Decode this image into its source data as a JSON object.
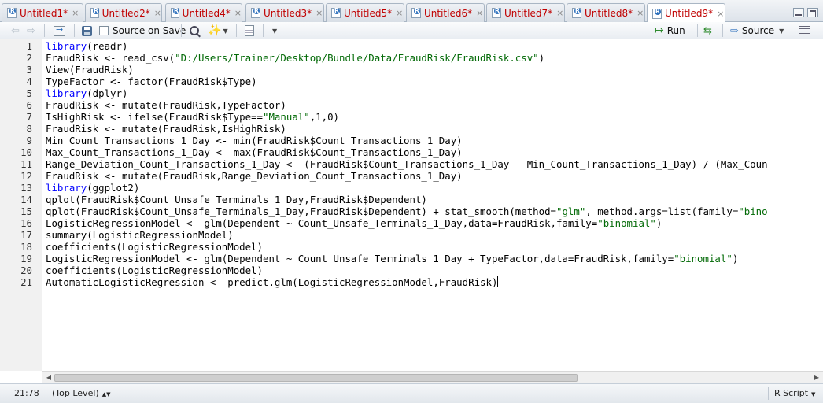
{
  "tabs": [
    {
      "label": "Untitled1*"
    },
    {
      "label": "Untitled2*"
    },
    {
      "label": "Untitled4*"
    },
    {
      "label": "Untitled3*"
    },
    {
      "label": "Untitled5*"
    },
    {
      "label": "Untitled6*"
    },
    {
      "label": "Untitled7*"
    },
    {
      "label": "Untitled8*"
    },
    {
      "label": "Untitled9*",
      "active": true
    }
  ],
  "tab_close_glyph": "×",
  "toolbar": {
    "source_on_save_label": "Source on Save",
    "run_label": "Run",
    "source_label": "Source"
  },
  "editor": {
    "lines": [
      {
        "n": "1",
        "code": "library(readr)"
      },
      {
        "n": "2",
        "code": "FraudRisk <- read_csv(\"D:/Users/Trainer/Desktop/Bundle/Data/FraudRisk/FraudRisk.csv\")"
      },
      {
        "n": "3",
        "code": "View(FraudRisk)"
      },
      {
        "n": "4",
        "code": "TypeFactor <- factor(FraudRisk$Type)"
      },
      {
        "n": "5",
        "code": "library(dplyr)"
      },
      {
        "n": "6",
        "code": "FraudRisk <- mutate(FraudRisk,TypeFactor)"
      },
      {
        "n": "7",
        "code": "IsHighRisk <- ifelse(FraudRisk$Type==\"Manual\",1,0)"
      },
      {
        "n": "8",
        "code": "FraudRisk <- mutate(FraudRisk,IsHighRisk)"
      },
      {
        "n": "9",
        "code": "Min_Count_Transactions_1_Day <- min(FraudRisk$Count_Transactions_1_Day)"
      },
      {
        "n": "10",
        "code": "Max_Count_Transactions_1_Day <- max(FraudRisk$Count_Transactions_1_Day)"
      },
      {
        "n": "11",
        "code": "Range_Deviation_Count_Transactions_1_Day <- (FraudRisk$Count_Transactions_1_Day - Min_Count_Transactions_1_Day) / (Max_Coun"
      },
      {
        "n": "12",
        "code": "FraudRisk <- mutate(FraudRisk,Range_Deviation_Count_Transactions_1_Day)"
      },
      {
        "n": "13",
        "code": "library(ggplot2)"
      },
      {
        "n": "14",
        "code": "qplot(FraudRisk$Count_Unsafe_Terminals_1_Day,FraudRisk$Dependent)"
      },
      {
        "n": "15",
        "code": "qplot(FraudRisk$Count_Unsafe_Terminals_1_Day,FraudRisk$Dependent) + stat_smooth(method=\"glm\", method.args=list(family=\"bino"
      },
      {
        "n": "16",
        "code": "LogisticRegressionModel <- glm(Dependent ~ Count_Unsafe_Terminals_1_Day,data=FraudRisk,family=\"binomial\")"
      },
      {
        "n": "17",
        "code": "summary(LogisticRegressionModel)"
      },
      {
        "n": "18",
        "code": "coefficients(LogisticRegressionModel)"
      },
      {
        "n": "19",
        "code": "LogisticRegressionModel <- glm(Dependent ~ Count_Unsafe_Terminals_1_Day + TypeFactor,data=FraudRisk,family=\"binomial\")"
      },
      {
        "n": "20",
        "code": "coefficients(LogisticRegressionModel)"
      },
      {
        "n": "21",
        "code": "AutomaticLogisticRegression <- predict.glm(LogisticRegressionModel,FraudRisk)"
      }
    ]
  },
  "status": {
    "position": "21:78",
    "scope": "(Top Level)",
    "file_type": "R Script"
  },
  "colors": {
    "keyword": "#0000ff",
    "string": "#036a07",
    "tab_label": "#c00000"
  }
}
